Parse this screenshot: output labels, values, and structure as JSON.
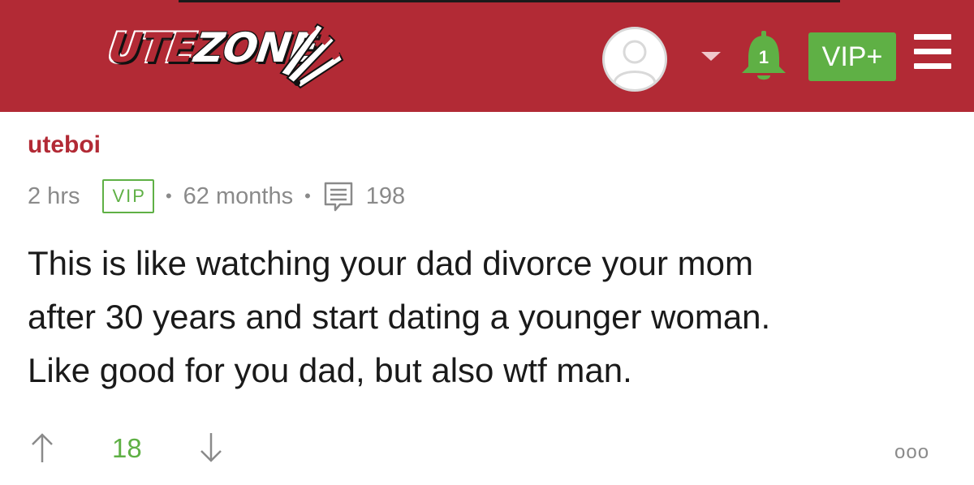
{
  "header": {
    "logo_text_part1": "UTE",
    "logo_text_part2": "ZONE",
    "notification_count": "1",
    "vip_button_label": "VIP+",
    "icons": [
      "avatar-icon",
      "chevron-down-icon",
      "bell-icon",
      "hamburger-menu-icon"
    ],
    "colors": {
      "header_bg": "#b22a35",
      "accent_green": "#5fb045"
    }
  },
  "post": {
    "username": "uteboi",
    "time_ago": "2 hrs",
    "badge": "VIP",
    "membership": "62 months",
    "post_count": "198",
    "body_line1": "This is like watching your dad divorce your mom",
    "body_line2": "after 30 years and start dating a younger woman.",
    "body_line3": "Like good for you dad, but also wtf man.",
    "score": "18",
    "more_label": "ooo",
    "icons": [
      "comment-icon",
      "upvote-arrow-icon",
      "downvote-arrow-icon",
      "more-options-icon"
    ]
  }
}
